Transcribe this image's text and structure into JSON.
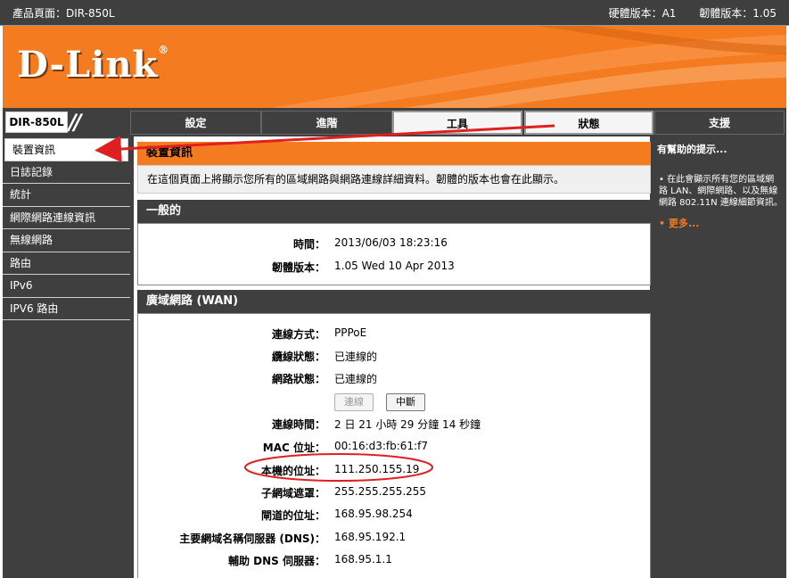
{
  "topbar": {
    "product": "產品頁面：DIR-850L",
    "hw": "硬體版本：A1",
    "fw": "韌體版本：1.05"
  },
  "brand": {
    "logo": "D-Link",
    "model": "DIR-850L",
    "color": "#f47b20"
  },
  "tabs": [
    {
      "label": "設定"
    },
    {
      "label": "進階"
    },
    {
      "label": "工具"
    },
    {
      "label": "狀態"
    },
    {
      "label": "支援"
    }
  ],
  "sidebar": {
    "items": [
      {
        "label": "裝置資訊"
      },
      {
        "label": "日誌記錄"
      },
      {
        "label": "統計"
      },
      {
        "label": "網際網路連線資訊"
      },
      {
        "label": "無線網路"
      },
      {
        "label": "路由"
      },
      {
        "label": "IPv6"
      },
      {
        "label": "IPV6 路由"
      }
    ]
  },
  "main": {
    "title": "裝置資訊",
    "intro": "在這個頁面上將顯示您所有的區域網路與網路連線詳細資料。韌體的版本也會在此顯示。",
    "general": {
      "title": "一般的",
      "time_label": "時間：",
      "time_value": "2013/06/03 18:23:16",
      "fw_label": "韌體版本：",
      "fw_value": "1.05 Wed 10 Apr 2013"
    },
    "wan": {
      "title": "廣域網路 (WAN)",
      "conn_type_label": "連線方式：",
      "conn_type_value": "PPPoE",
      "cable_label": "纜線狀態：",
      "cable_value": "已連線的",
      "net_label": "網路狀態：",
      "net_value": "已連線的",
      "connect_btn": "連線",
      "disconnect_btn": "中斷",
      "uptime_label": "連線時間：",
      "uptime_value": "2 日 21 小時 29 分鐘 14 秒鐘",
      "mac_label": "MAC 位址：",
      "mac_value": "00:16:d3:fb:61:f7",
      "ip_label": "本機的位址：",
      "ip_value": "111.250.155.19",
      "mask_label": "子網域遮罩：",
      "mask_value": "255.255.255.255",
      "gw_label": "閘道的位址：",
      "gw_value": "168.95.98.254",
      "dns1_label": "主要網域名稱伺服器 (DNS)：",
      "dns1_value": "168.95.192.1",
      "dns2_label": "輔助 DNS 伺服器：",
      "dns2_value": "168.95.1.1"
    }
  },
  "help": {
    "title": "有幫助的提示...",
    "text": "在此會顯示所有您的區域網路 LAN、網際網路、以及無線網路 802.11N 連線細節資訊。",
    "more": "更多..."
  }
}
